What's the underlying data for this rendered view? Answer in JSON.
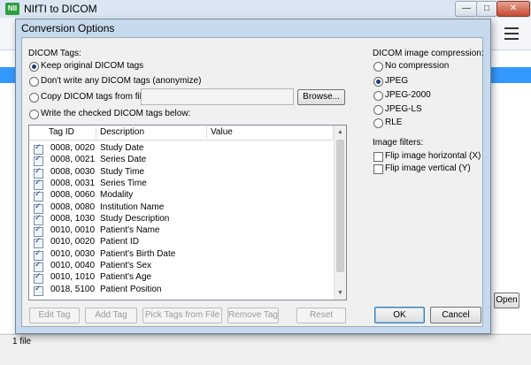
{
  "app": {
    "title": "NIfTI to DICOM",
    "badge": "NII"
  },
  "main": {
    "status": "1 file",
    "open_label": "Open"
  },
  "dialog": {
    "title": "Conversion Options",
    "tags_section_label": "DICOM Tags:",
    "tag_options": [
      {
        "label": "Keep original DICOM tags",
        "selected": true
      },
      {
        "label": "Don't write any DICOM tags (anonymize)",
        "selected": false
      },
      {
        "label": "Copy DICOM tags from file:",
        "selected": false
      },
      {
        "label": "Write the checked DICOM tags below:",
        "selected": false
      }
    ],
    "copy_file_value": "",
    "browse_label": "Browse...",
    "table": {
      "headers": [
        "Tag ID",
        "Description",
        "Value"
      ],
      "rows": [
        {
          "tag": "0008, 0020",
          "desc": "Study Date",
          "value": ""
        },
        {
          "tag": "0008, 0021",
          "desc": "Series Date",
          "value": ""
        },
        {
          "tag": "0008, 0030",
          "desc": "Study Time",
          "value": ""
        },
        {
          "tag": "0008, 0031",
          "desc": "Series Time",
          "value": ""
        },
        {
          "tag": "0008, 0060",
          "desc": "Modality",
          "value": ""
        },
        {
          "tag": "0008, 0080",
          "desc": "Institution Name",
          "value": ""
        },
        {
          "tag": "0008, 1030",
          "desc": "Study Description",
          "value": ""
        },
        {
          "tag": "0010, 0010",
          "desc": "Patient's Name",
          "value": ""
        },
        {
          "tag": "0010, 0020",
          "desc": "Patient ID",
          "value": ""
        },
        {
          "tag": "0010, 0030",
          "desc": "Patient's Birth Date",
          "value": ""
        },
        {
          "tag": "0010, 0040",
          "desc": "Patient's Sex",
          "value": ""
        },
        {
          "tag": "0010, 1010",
          "desc": "Patient's Age",
          "value": ""
        },
        {
          "tag": "0018, 5100",
          "desc": "Patient Position",
          "value": ""
        }
      ]
    },
    "tag_buttons": [
      "Edit Tag",
      "Add Tag",
      "Pick Tags from File",
      "Remove Tag",
      "Reset"
    ],
    "compression_label": "DICOM image compression:",
    "compression_options": [
      {
        "label": "No compression",
        "selected": false
      },
      {
        "label": "JPEG",
        "selected": true
      },
      {
        "label": "JPEG-2000",
        "selected": false
      },
      {
        "label": "JPEG-LS",
        "selected": false
      },
      {
        "label": "RLE",
        "selected": false
      }
    ],
    "filters_label": "Image filters:",
    "filters": [
      {
        "label": "Flip image horizontal (X)",
        "checked": false
      },
      {
        "label": "Flip image vertical (Y)",
        "checked": false
      }
    ],
    "ok_label": "OK",
    "cancel_label": "Cancel"
  },
  "colors": {
    "selection": "#3399ff",
    "dialog_frame": "#c7d9ec",
    "radio_dot": "#1a3f7a"
  }
}
